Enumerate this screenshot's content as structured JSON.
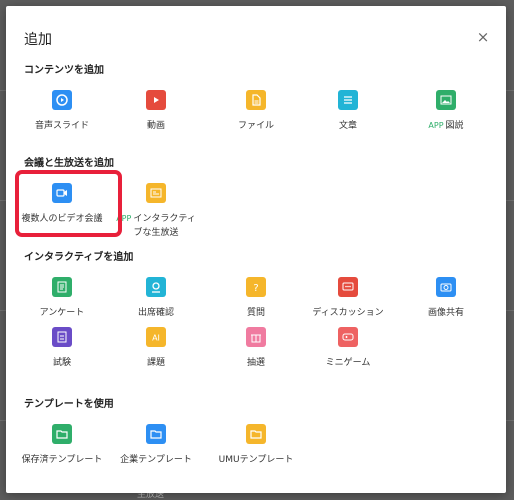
{
  "dialog": {
    "title": "追加",
    "close_glyph": "×"
  },
  "sections": [
    {
      "title": "コンテンツを追加",
      "items": [
        {
          "label": "音声スライド",
          "color": "#2d8ff3",
          "icon": "audio-slide-icon"
        },
        {
          "label": "動画",
          "color": "#e54b3d",
          "icon": "video-icon"
        },
        {
          "label": "ファイル",
          "color": "#f5b62b",
          "icon": "file-icon"
        },
        {
          "label": "文章",
          "color": "#22b4d6",
          "icon": "article-icon"
        },
        {
          "app": "APP",
          "label": "図説",
          "color": "#2fae6a",
          "icon": "illustration-icon"
        }
      ]
    },
    {
      "title": "会議と生放送を追加",
      "items": [
        {
          "label": "複数人のビデオ会議",
          "color": "#2d8ff3",
          "icon": "video-conference-icon"
        },
        {
          "app": "APP",
          "label": "インタラクティ",
          "label2": "ブな生放送",
          "color": "#f5b62b",
          "icon": "live-broadcast-icon"
        }
      ]
    },
    {
      "title": "インタラクティブを追加",
      "items": [
        {
          "label": "アンケート",
          "color": "#2fae6a",
          "icon": "survey-icon"
        },
        {
          "label": "出席確認",
          "color": "#22b4d6",
          "icon": "attendance-icon"
        },
        {
          "label": "質問",
          "color": "#f5b62b",
          "icon": "question-icon"
        },
        {
          "label": "ディスカッション",
          "color": "#e54b3d",
          "icon": "discussion-icon"
        },
        {
          "label": "画像共有",
          "color": "#2d8ff3",
          "icon": "image-share-icon"
        },
        {
          "label": "試験",
          "color": "#6a4cc7",
          "icon": "exam-icon"
        },
        {
          "label": "課題",
          "color": "#f5b62b",
          "icon": "assignment-icon"
        },
        {
          "label": "抽選",
          "color": "#f07ba0",
          "icon": "lottery-icon"
        },
        {
          "label": "ミニゲーム",
          "color": "#ee6262",
          "icon": "minigame-icon"
        }
      ]
    },
    {
      "title": "テンプレートを使用",
      "items": [
        {
          "label": "保存済テンプレート",
          "color": "#2fae6a",
          "icon": "saved-template-icon"
        },
        {
          "label": "企業テンプレート",
          "color": "#2d8ff3",
          "icon": "company-template-icon"
        },
        {
          "label": "UMUテンプレート",
          "color": "#f5b62b",
          "icon": "umu-template-icon"
        }
      ]
    }
  ],
  "background": {
    "partial_text": "生放送"
  }
}
